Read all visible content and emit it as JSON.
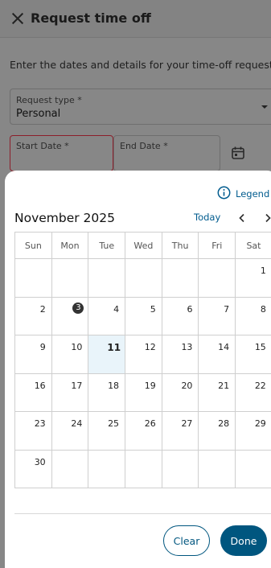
{
  "header": {
    "title": "Request time off",
    "close_icon": "close-icon"
  },
  "form": {
    "intro": "Enter the dates and details for your time-off request.",
    "request_type": {
      "label": "Request type *",
      "value": "Personal"
    },
    "start_date": {
      "label": "Start Date *",
      "value": ""
    },
    "end_date": {
      "label": "End Date *",
      "value": ""
    },
    "calendar_icon": "calendar-icon"
  },
  "calendar": {
    "legend_label": "Legend",
    "legend_icon": "info-icon",
    "month_title": "November 2025",
    "today_label": "Today",
    "prev_icon": "chevron-left-icon",
    "next_icon": "chevron-right-icon",
    "weekdays": [
      "Sun",
      "Mon",
      "Tue",
      "Wed",
      "Thu",
      "Fri",
      "Sat"
    ],
    "weeks": [
      [
        "",
        "",
        "",
        "",
        "",
        "",
        "1"
      ],
      [
        "2",
        "3",
        "4",
        "5",
        "6",
        "7",
        "8"
      ],
      [
        "9",
        "10",
        "11",
        "12",
        "13",
        "14",
        "15"
      ],
      [
        "16",
        "17",
        "18",
        "19",
        "20",
        "21",
        "22"
      ],
      [
        "23",
        "24",
        "25",
        "26",
        "27",
        "28",
        "29"
      ],
      [
        "30",
        "",
        "",
        "",
        "",
        "",
        ""
      ]
    ],
    "today_day": "11",
    "marked_day": "3",
    "colors": {
      "accent": "#00567f",
      "today_bg": "#e9f4fa",
      "marked_dot": "#333333",
      "error_border": "#8c1f2b"
    }
  },
  "actions": {
    "clear_label": "Clear",
    "done_label": "Done"
  }
}
